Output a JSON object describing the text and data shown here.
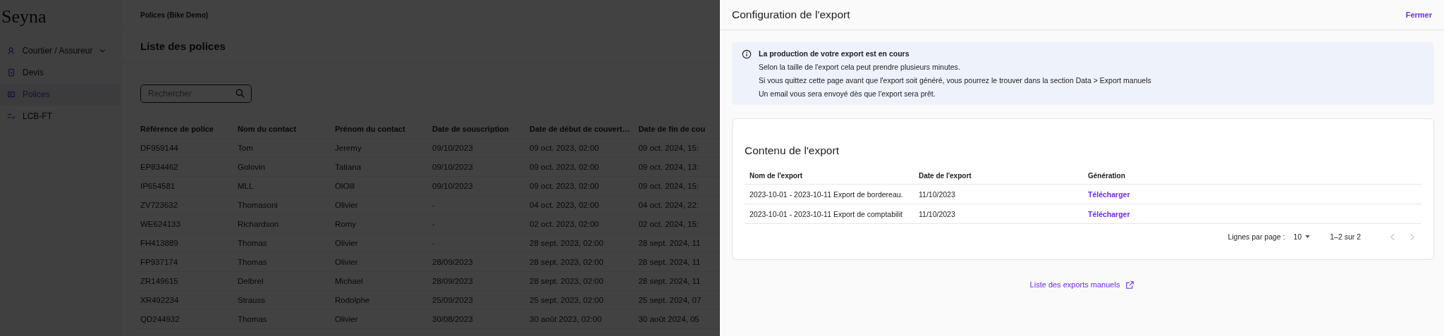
{
  "sidebar": {
    "logo": "Seyna",
    "items": [
      {
        "label": "Courtier / Assureur",
        "selected": false,
        "expanded": false
      },
      {
        "label": "Devis",
        "selected": false
      },
      {
        "label": "Polices",
        "selected": true
      },
      {
        "label": "LCB-FT",
        "selected": false
      }
    ]
  },
  "breadcrumb": "Polices (Bike Demo)",
  "page_title": "Liste des polices",
  "search": {
    "placeholder": "Rechercher"
  },
  "table": {
    "columns": [
      "Référence de police",
      "Nom du contact",
      "Prénom du contact",
      "Date de souscription",
      "Date de début de couvert…",
      "Date de fin de cou"
    ],
    "rows": [
      [
        "DF959144",
        "Tom",
        "Jeremy",
        "09/10/2023",
        "09 oct. 2023, 02:00",
        "09 oct. 2024, 15:"
      ],
      [
        "EP834462",
        "Golovin",
        "Tatiana",
        "09/10/2023",
        "09 oct. 2023, 02:00",
        "09 oct. 2024, 13:"
      ],
      [
        "IP654581",
        "MLL",
        "OlOlll",
        "09/10/2023",
        "09 oct. 2023, 02:00",
        "09 oct. 2024, 15:"
      ],
      [
        "ZV723632",
        "Thomasoni",
        "Olivier",
        "-",
        "04 oct. 2023, 02:00",
        "04 oct. 2024, 22:"
      ],
      [
        "WE624133",
        "Richardson",
        "Romy",
        "-",
        "02 oct. 2023, 02:00",
        "02 oct. 2024, 15:"
      ],
      [
        "FH413889",
        "Thomas",
        "Olivier",
        "-",
        "28 sept. 2023, 02:00",
        "28 sept. 2024, 11"
      ],
      [
        "FP937174",
        "Thomas",
        "Olivier",
        "28/09/2023",
        "28 sept. 2023, 02:00",
        "28 sept. 2024, 11"
      ],
      [
        "ZR149615",
        "Delbrel",
        "Michael",
        "28/09/2023",
        "28 sept. 2023, 02:00",
        "28 sept. 2024, 11"
      ],
      [
        "XR492234",
        "Strauss",
        "Rodolphe",
        "25/09/2023",
        "25 sept. 2023, 02:00",
        "25 sept. 2024, 07"
      ],
      [
        "QD244932",
        "Thomas",
        "Olivier",
        "30/08/2023",
        "30 août 2023, 02:00",
        "30 août 2024, 05"
      ]
    ]
  },
  "drawer": {
    "title": "Configuration de l'export",
    "close": "Fermer",
    "info": {
      "title": "La production de votre export est en cours",
      "lines": [
        "Selon la taille de l'export cela peut prendre plusieurs minutes.",
        "Si vous quittez cette page avant que l'export soit généré, vous pourrez le trouver dans la section Data > Export manuels",
        "Un email vous sera envoyé dès que l'export sera prêt."
      ]
    },
    "card": {
      "title": "Contenu de l'export",
      "columns": [
        "Nom de l'export",
        "Date de l'export",
        "Génération"
      ],
      "rows": [
        {
          "name": "2023-10-01 - 2023-10-11 Export de bordereau.",
          "date": "11/10/2023",
          "action": "Télécharger"
        },
        {
          "name": "2023-10-01 - 2023-10-11 Export de comptabilit",
          "date": "11/10/2023",
          "action": "Télécharger"
        }
      ],
      "pagination": {
        "rows_label": "Lignes par page :",
        "rows_value": "10",
        "range": "1–2 sur 2",
        "prev": {
          "disabled": true
        },
        "next": {
          "disabled": true
        }
      }
    },
    "link": "Liste des exports manuels"
  }
}
